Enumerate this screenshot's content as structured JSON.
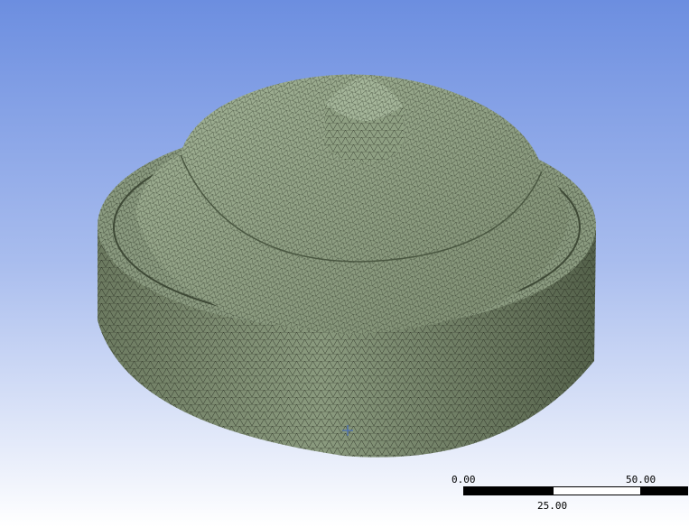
{
  "viewport": {
    "background_top": "#6c8ee0",
    "background_bottom": "#ffffff",
    "mesh_fill": "#8f9f84",
    "mesh_line": "#1e2418"
  },
  "model": {
    "icon": "meshed-part-icon"
  },
  "origin_marker": {
    "icon": "origin-cross-icon",
    "color": "#4a6fb5"
  },
  "scale_bar": {
    "min_label": "0.00",
    "mid_label": "25.00",
    "max_label": "50.00"
  }
}
